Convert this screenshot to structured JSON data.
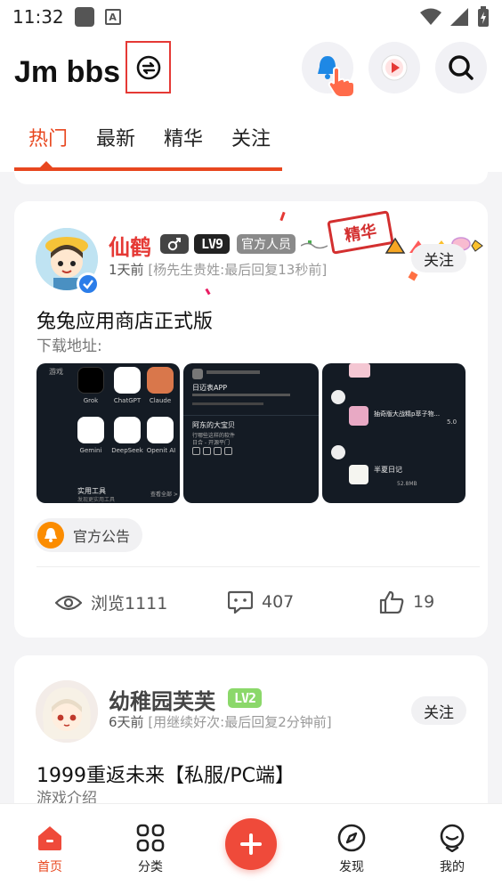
{
  "status_bar": {
    "time": "11:32"
  },
  "app": {
    "title": "Jm bbs"
  },
  "tabs": [
    {
      "label": "热门",
      "active": true
    },
    {
      "label": "最新",
      "active": false
    },
    {
      "label": "精华",
      "active": false
    },
    {
      "label": "关注",
      "active": false
    }
  ],
  "posts": [
    {
      "author": "仙鹤",
      "level": "LV9",
      "role_badge": "官方人员",
      "featured_stamp": "精华",
      "time": "1天前",
      "last_reply": "[杨先生贵姓:最后回复13秒前]",
      "follow_label": "关注",
      "title": "兔兔应用商店正式版",
      "subtitle": "下载地址:",
      "shots": {
        "a": {
          "header": "游戏",
          "apps": [
            "Grok",
            "ChatGPT",
            "Claude",
            "Gemini",
            "DeepSeek",
            "Openit AI"
          ],
          "section": "实用工具",
          "section_note": "发现更实用工具",
          "more": "查看全部 >"
        },
        "b": {
          "item1": "日迈表APP",
          "item2": "阿东的大宝贝",
          "item2_sub": "行哪些这样的软件",
          "item2_sub2": "日合 - 开源平门"
        },
        "c": {
          "item1": "抽奇版大战精p萃子物...",
          "item2": "半夏日记",
          "rating": "5.0",
          "item2_size": "52.8MB"
        }
      },
      "tag": "官方公告",
      "views": "浏览1111",
      "comments": "407",
      "likes": "19"
    },
    {
      "author": "幼稚园芙芙",
      "level": "LV2",
      "time": "6天前",
      "last_reply": "[用继续好次:最后回复2分钟前]",
      "follow_label": "关注",
      "title": "1999重返未来【私服/PC端】",
      "subtitle": "游戏介绍"
    }
  ],
  "bottom_nav": [
    {
      "label": "首页",
      "icon": "home-icon",
      "active": true
    },
    {
      "label": "分类",
      "icon": "grid-icon",
      "active": false
    },
    {
      "label": "发现",
      "icon": "compass-icon",
      "active": false
    },
    {
      "label": "我的",
      "icon": "profile-icon",
      "active": false
    }
  ],
  "colors": {
    "accent": "#e8471f",
    "verify": "#2b7de9",
    "tag": "#fb8c00",
    "plus": "#ef4a3a",
    "lv9": "#222222",
    "lv2": "#8bd86a",
    "role_badge": "#8a8a8a"
  }
}
